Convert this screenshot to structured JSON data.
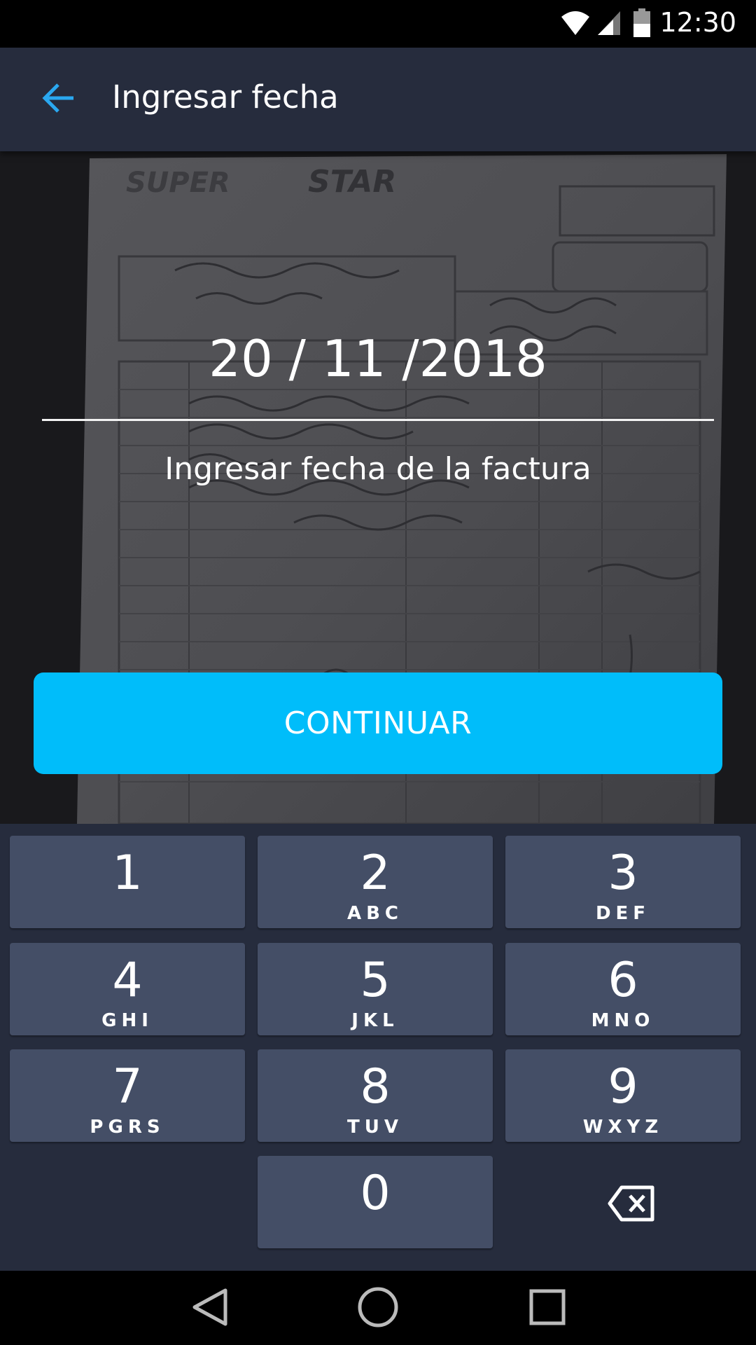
{
  "status_bar": {
    "time": "12:30"
  },
  "app_bar": {
    "title": "Ingresar fecha"
  },
  "date_entry": {
    "value": "20 / 11 /2018",
    "hint": "Ingresar fecha de la factura"
  },
  "continue_button": {
    "label": "CONTINUAR"
  },
  "keypad": {
    "keys": [
      {
        "num": "1",
        "letters": ""
      },
      {
        "num": "2",
        "letters": "ABC"
      },
      {
        "num": "3",
        "letters": "DEF"
      },
      {
        "num": "4",
        "letters": "GHI"
      },
      {
        "num": "5",
        "letters": "JKL"
      },
      {
        "num": "6",
        "letters": "MNO"
      },
      {
        "num": "7",
        "letters": "PGRS"
      },
      {
        "num": "8",
        "letters": "TUV"
      },
      {
        "num": "9",
        "letters": "WXYZ"
      },
      {
        "num": "0",
        "letters": ""
      }
    ]
  },
  "colors": {
    "accent": "#00bdfa",
    "app_bar": "#262c3d",
    "key": "#444e66"
  }
}
